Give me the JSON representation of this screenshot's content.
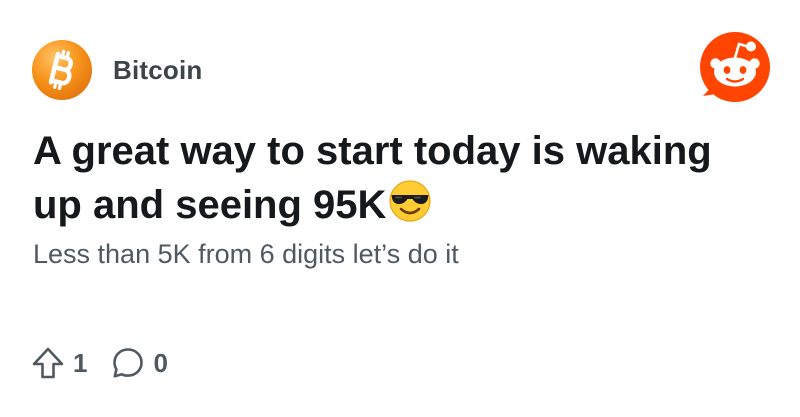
{
  "community": {
    "name": "Bitcoin",
    "avatar_icon": "bitcoin-icon",
    "avatar_color": "#f7931a"
  },
  "brand": {
    "icon": "reddit-logo-icon",
    "color": "#ff4500"
  },
  "post": {
    "title": "A great way to start today is waking up and seeing 95K",
    "title_emoji": "smiling-face-with-sunglasses-icon",
    "body": "Less than 5K from 6 digits let’s do it"
  },
  "actions": {
    "upvote_icon": "upvote-arrow-icon",
    "upvote_count": "1",
    "comment_icon": "comment-bubble-icon",
    "comment_count": "0"
  }
}
